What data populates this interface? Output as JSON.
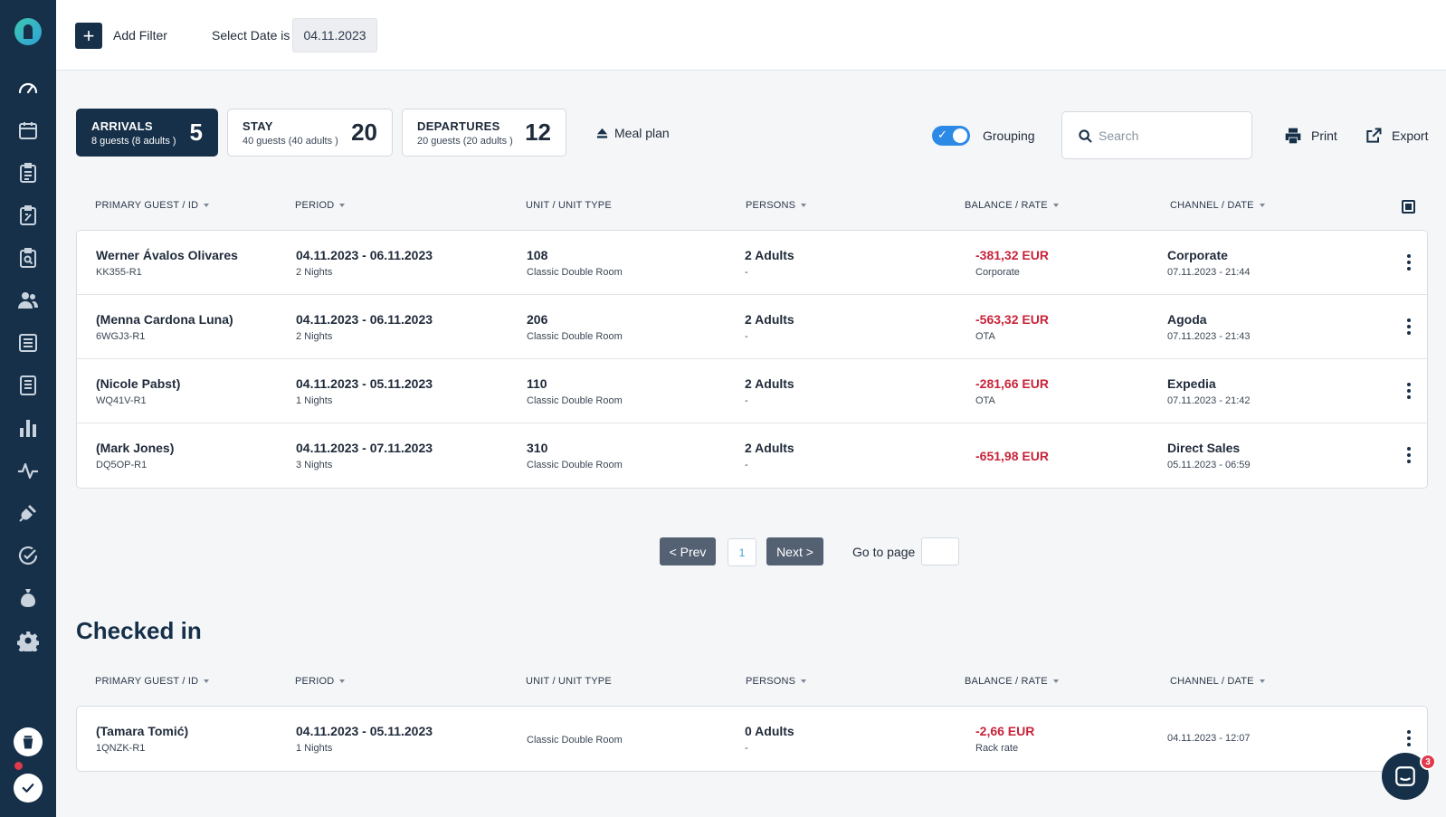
{
  "colors": {
    "sidebar": "#163049",
    "accent": "#2c8ae6",
    "negative": "#c8243a",
    "pagination": "#546173"
  },
  "sidebar": {
    "icons": [
      "dashboard-icon",
      "calendar-icon",
      "clipboard-list-icon",
      "clipboard-edit-icon",
      "clipboard-search-icon",
      "users-icon",
      "list-icon",
      "document-icon",
      "bar-chart-icon",
      "activity-icon",
      "plug-icon",
      "check-circle-icon",
      "money-bag-icon",
      "gear-icon"
    ],
    "bottom_icons": [
      "coffee-cup-icon",
      "check-icon"
    ]
  },
  "toolbar": {
    "add_filter_label": "Add Filter",
    "date_label": "Select Date is",
    "date_value": "04.11.2023"
  },
  "stats": [
    {
      "title": "ARRIVALS",
      "sub": "8 guests (8 adults )",
      "count": "5"
    },
    {
      "title": "STAY",
      "sub": "40 guests (40 adults )",
      "count": "20"
    },
    {
      "title": "DEPARTURES",
      "sub": "20 guests (20 adults )",
      "count": "12"
    }
  ],
  "meal_plan_label": "Meal plan",
  "grouping_label": "Grouping",
  "search": {
    "placeholder": "Search"
  },
  "actions": {
    "print": "Print",
    "export": "Export"
  },
  "columns": [
    "PRIMARY GUEST / ID",
    "PERIOD",
    "UNIT / UNIT TYPE",
    "PERSONS",
    "BALANCE / RATE",
    "CHANNEL / DATE"
  ],
  "arrivals": [
    {
      "guest": "Werner Ávalos Olivares",
      "id": "KK355-R1",
      "period": "04.11.2023 - 06.11.2023",
      "nights": "2 Nights",
      "unit": "108",
      "unit_type": "Classic Double Room",
      "persons": "2 Adults",
      "persons_sub": "-",
      "balance": "-381,32 EUR",
      "rate": "Corporate",
      "channel": "Corporate",
      "date": "07.11.2023 - 21:44"
    },
    {
      "guest": "(Menna Cardona Luna)",
      "id": "6WGJ3-R1",
      "period": "04.11.2023 - 06.11.2023",
      "nights": "2 Nights",
      "unit": "206",
      "unit_type": "Classic Double Room",
      "persons": "2 Adults",
      "persons_sub": "-",
      "balance": "-563,32 EUR",
      "rate": "OTA",
      "channel": "Agoda",
      "date": "07.11.2023 - 21:43"
    },
    {
      "guest": "(Nicole Pabst)",
      "id": "WQ41V-R1",
      "period": "04.11.2023 - 05.11.2023",
      "nights": "1 Nights",
      "unit": "110",
      "unit_type": "Classic Double Room",
      "persons": "2 Adults",
      "persons_sub": "-",
      "balance": "-281,66 EUR",
      "rate": "OTA",
      "channel": "Expedia",
      "date": "07.11.2023 - 21:42"
    },
    {
      "guest": "(Mark Jones)",
      "id": "DQ5OP-R1",
      "period": "04.11.2023 - 07.11.2023",
      "nights": "3 Nights",
      "unit": "310",
      "unit_type": "Classic Double Room",
      "persons": "2 Adults",
      "persons_sub": "-",
      "balance": "-651,98 EUR",
      "rate": "",
      "channel": "Direct Sales",
      "date": "05.11.2023 - 06:59"
    }
  ],
  "pagination": {
    "prev": "< Prev",
    "page": "1",
    "next": "Next >",
    "goto_label": "Go to page",
    "goto_value": ""
  },
  "checked_in": {
    "title": "Checked in",
    "rows": [
      {
        "guest": "(Tamara Tomić)",
        "id": "1QNZK-R1",
        "period": "04.11.2023 - 05.11.2023",
        "nights": "1 Nights",
        "unit": "",
        "unit_type": "Classic Double Room",
        "persons": "0 Adults",
        "persons_sub": "-",
        "balance": "-2,66 EUR",
        "rate": "Rack rate",
        "channel": "",
        "date": "04.11.2023 - 12:07"
      }
    ]
  },
  "chat": {
    "badge": "3"
  }
}
